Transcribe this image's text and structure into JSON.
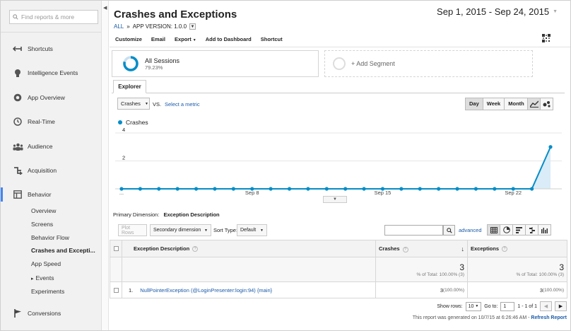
{
  "sidebar": {
    "search_placeholder": "Find reports & more",
    "nav": [
      {
        "label": "Shortcuts",
        "icon": "shortcuts-arrow-icon"
      },
      {
        "label": "Intelligence Events",
        "icon": "lightbulb-icon"
      },
      {
        "label": "App Overview",
        "icon": "app-overview-icon"
      },
      {
        "label": "Real-Time",
        "icon": "clock-icon"
      },
      {
        "label": "Audience",
        "icon": "people-icon"
      },
      {
        "label": "Acquisition",
        "icon": "acquisition-arrows-icon"
      },
      {
        "label": "Behavior",
        "icon": "behavior-layout-icon"
      }
    ],
    "behavior_items": [
      "Overview",
      "Screens",
      "Behavior Flow",
      "Crashes and Excepti...",
      "App Speed",
      "Events",
      "Experiments"
    ],
    "events_arrow": "▸",
    "conversions": "Conversions"
  },
  "header": {
    "title": "Crashes and Exceptions",
    "crumb_all": "ALL",
    "crumb_sep": "»",
    "crumb_filter": "APP VERSION: 1.0.0",
    "date_range": "Sep 1, 2015 - Sep 24, 2015"
  },
  "toolbar": {
    "customize": "Customize",
    "email": "Email",
    "export": "Export",
    "add_dashboard": "Add to Dashboard",
    "shortcut": "Shortcut"
  },
  "segments": {
    "all_sessions": "All Sessions",
    "all_sessions_pct": "79.23%",
    "add_segment": "+ Add Segment"
  },
  "explorer": {
    "tab": "Explorer",
    "metric": "Crashes",
    "vs": "VS.",
    "select_metric": "Select a metric",
    "periods": [
      "Day",
      "Week",
      "Month"
    ],
    "selected_period": "Day",
    "legend": "Crashes",
    "series_color": "#058dc7"
  },
  "chart_data": {
    "type": "area",
    "series": [
      {
        "name": "Crashes",
        "values": [
          0,
          0,
          0,
          0,
          0,
          0,
          0,
          0,
          0,
          0,
          0,
          0,
          0,
          0,
          0,
          0,
          0,
          0,
          0,
          0,
          0,
          0,
          0,
          3
        ]
      }
    ],
    "x": [
      "Sep 1",
      "Sep 2",
      "Sep 3",
      "Sep 4",
      "Sep 5",
      "Sep 6",
      "Sep 7",
      "Sep 8",
      "Sep 9",
      "Sep 10",
      "Sep 11",
      "Sep 12",
      "Sep 13",
      "Sep 14",
      "Sep 15",
      "Sep 16",
      "Sep 17",
      "Sep 18",
      "Sep 19",
      "Sep 20",
      "Sep 21",
      "Sep 22",
      "Sep 23",
      "Sep 24"
    ],
    "x_tick_labels": [
      "...",
      "Sep 8",
      "Sep 15",
      "Sep 22"
    ],
    "x_tick_indices": [
      0,
      7,
      14,
      21
    ],
    "y_ticks": [
      2,
      4
    ],
    "ylim": [
      0,
      4
    ],
    "grid": true
  },
  "table": {
    "primary_label": "Primary Dimension:",
    "primary_value": "Exception Description",
    "plot_rows": "Plot Rows",
    "secondary_dimension": "Secondary dimension",
    "sort_type_label": "Sort Type:",
    "sort_type_value": "Default",
    "advanced": "advanced",
    "columns": {
      "desc": "Exception Description",
      "crashes": "Crashes",
      "exceptions": "Exceptions"
    },
    "totals": {
      "crashes": "3",
      "crashes_pct": "% of Total: 100.00% (3)",
      "exceptions": "3",
      "exceptions_pct": "% of Total: 100.00% (3)"
    },
    "rows": [
      {
        "index": "1.",
        "desc": "NullPointerException (@LoginPresenter:login:94) {main}",
        "crashes": "3",
        "crashes_pct": "(100.00%)",
        "exceptions": "3",
        "exceptions_pct": "(100.00%)"
      }
    ],
    "show_rows_label": "Show rows:",
    "show_rows_value": "10",
    "goto_label": "Go to:",
    "goto_value": "1",
    "range_text": "1 - 1 of 1",
    "generated_text": "This report was generated on 10/7/15 at 6:26:46 AM -",
    "refresh": "Refresh Report"
  }
}
